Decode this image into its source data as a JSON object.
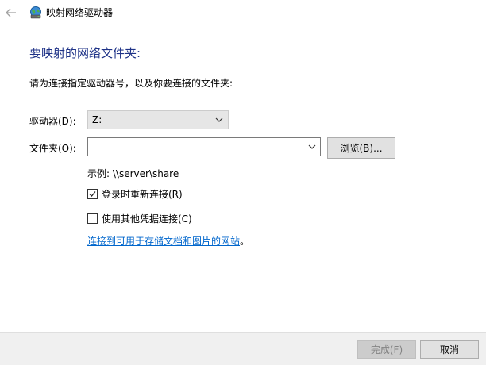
{
  "window": {
    "title": "映射网络驱动器",
    "icons": {
      "back": "back-arrow-icon",
      "app": "network-drive-icon"
    }
  },
  "main": {
    "heading": "要映射的网络文件夹:",
    "instruction": "请为连接指定驱动器号，以及你要连接的文件夹:",
    "drive": {
      "label": "驱动器(D):",
      "selected": "Z:"
    },
    "folder": {
      "label": "文件夹(O):",
      "value": "",
      "placeholder": ""
    },
    "browse_label": "浏览(B)...",
    "example": "示例: \\\\server\\share",
    "reconnect": {
      "label": "登录时重新连接(R)",
      "checked": true
    },
    "other_credentials": {
      "label": "使用其他凭据连接(C)",
      "checked": false
    },
    "link_text": "连接到可用于存储文档和图片的网站",
    "link_suffix": "。"
  },
  "footer": {
    "finish_label": "完成(F)",
    "cancel_label": "取消"
  },
  "colors": {
    "heading": "#1e3287",
    "link": "#0066cc",
    "footer_bg": "#f0f0f0"
  }
}
